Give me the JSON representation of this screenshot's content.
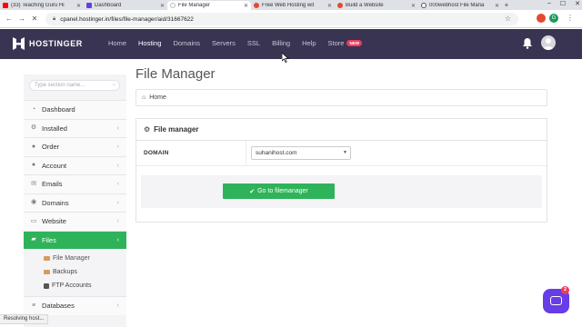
{
  "browser": {
    "tabs": [
      {
        "title": "(33) Teaching Guru Hi",
        "favicon_color": "#ff0000",
        "active": false
      },
      {
        "title": "Dashboard",
        "favicon_color": "#673de6",
        "active": false
      },
      {
        "title": "File Manager",
        "favicon_color": "#bbbbbb",
        "active": true
      },
      {
        "title": "Free Web Hosting wit",
        "favicon_color": "#e34a2f",
        "active": false
      },
      {
        "title": "Build a Website",
        "favicon_color": "#e34a2f",
        "active": false
      },
      {
        "title": "000webhost File Mana",
        "favicon_color": "#555555",
        "active": false
      }
    ],
    "new_tab": "+",
    "url": "cpanel.hostinger.in/files/file-manager/aid/31667622",
    "profile_letter": "G",
    "status_text": "Resolving host..."
  },
  "topnav": {
    "brand": "HOSTINGER",
    "links": [
      {
        "label": "Home",
        "current": false
      },
      {
        "label": "Hosting",
        "current": true
      },
      {
        "label": "Domains",
        "current": false
      },
      {
        "label": "Servers",
        "current": false
      },
      {
        "label": "SSL",
        "current": false
      },
      {
        "label": "Billing",
        "current": false
      },
      {
        "label": "Help",
        "current": false
      },
      {
        "label": "Store",
        "current": false
      }
    ],
    "store_badge": "NEW"
  },
  "sidebar": {
    "search_placeholder": "Type section name...",
    "items": [
      {
        "label": "Dashboard",
        "icon": "dashboard-icon",
        "chevron": false,
        "active": false
      },
      {
        "label": "Installed",
        "icon": "gears-icon",
        "chevron": true,
        "active": false
      },
      {
        "label": "Order",
        "icon": "info-icon",
        "chevron": true,
        "active": false
      },
      {
        "label": "Account",
        "icon": "user-icon",
        "chevron": true,
        "active": false
      },
      {
        "label": "Emails",
        "icon": "envelope-icon",
        "chevron": true,
        "active": false
      },
      {
        "label": "Domains",
        "icon": "globe-icon",
        "chevron": true,
        "active": false
      },
      {
        "label": "Website",
        "icon": "monitor-icon",
        "chevron": true,
        "active": false
      },
      {
        "label": "Files",
        "icon": "folder-icon",
        "chevron": true,
        "active": true
      }
    ],
    "subitems": [
      {
        "label": "File Manager",
        "icon": "folder-icon"
      },
      {
        "label": "Backups",
        "icon": "folder-icon"
      },
      {
        "label": "FTP Accounts",
        "icon": "server-icon"
      }
    ],
    "after_items": [
      {
        "label": "Databases",
        "icon": "database-icon",
        "chevron": true
      }
    ]
  },
  "main": {
    "title": "File Manager",
    "breadcrumb": "Home",
    "panel": {
      "title": "File manager",
      "domain_label": "DOMAIN",
      "domain_value": "suhanihost.com",
      "button_label": "Go to filemanager"
    }
  },
  "chat": {
    "unread": "2"
  },
  "colors": {
    "nav_bg": "#3a3453",
    "accent_green": "#2fb35a",
    "chat_purple": "#673de6",
    "badge_red": "#ef3b5e"
  }
}
